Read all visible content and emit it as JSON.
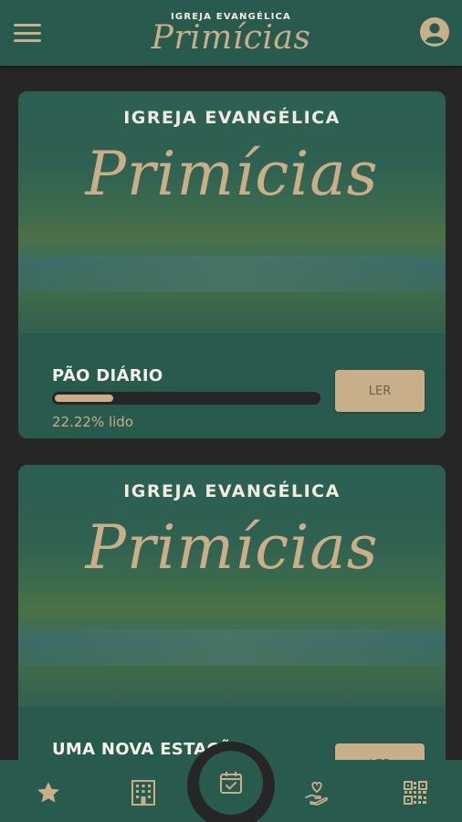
{
  "header": {
    "logo_sup": "IGREJA EVANGÉLICA",
    "logo_script": "Primícias",
    "menu_icon": "hamburger-menu-icon",
    "avatar_icon": "account-circle-icon"
  },
  "cards": [
    {
      "banner_sup": "IGREJA EVANGÉLICA",
      "banner_script": "Primícias",
      "title": "PÃO DIÁRIO",
      "progress_fraction": 0.2222,
      "progress_text": "22.22% lido",
      "button_label": "LER"
    },
    {
      "banner_sup": "IGREJA EVANGÉLICA",
      "banner_script": "Primícias",
      "title": "UMA NOVA ESTAÇÃO",
      "button_label": "LER"
    }
  ],
  "bottom_nav": {
    "items": [
      {
        "icon": "star-icon"
      },
      {
        "icon": "building-icon"
      },
      {
        "icon": "calendar-check-icon"
      },
      {
        "icon": "hand-heart-icon"
      },
      {
        "icon": "qr-code-icon"
      }
    ]
  },
  "colors": {
    "primary": "#285a4e",
    "accent": "#c9ae8a",
    "background": "#262626",
    "text_light": "#f5f2ea"
  }
}
